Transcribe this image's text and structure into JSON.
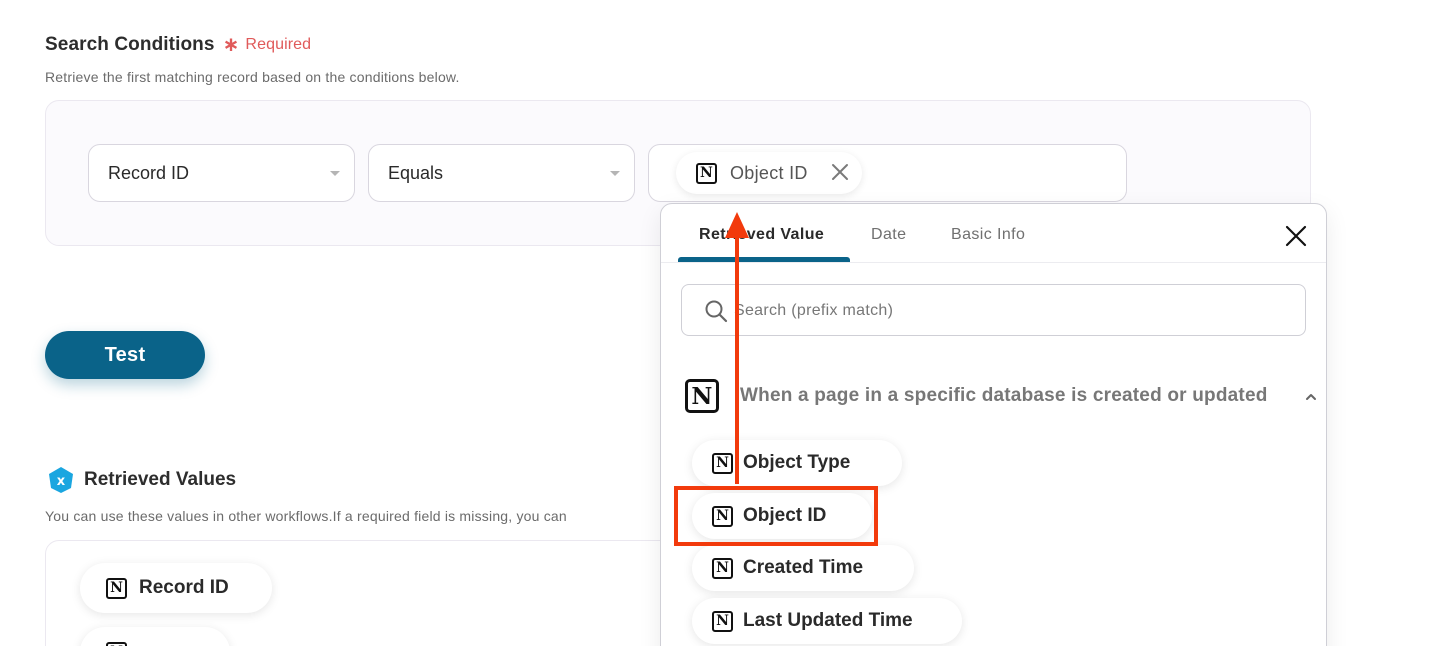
{
  "search_conditions": {
    "title": "Search Conditions",
    "required_star": "∗",
    "required_label": "Required",
    "description": "Retrieve the first matching record based on the conditions below.",
    "field_select": {
      "value": "Record ID"
    },
    "operator_select": {
      "value": "Equals"
    },
    "value_chip": {
      "label": "Object ID",
      "icon": "notion-icon"
    }
  },
  "test_button": {
    "label": "Test"
  },
  "retrieved_values": {
    "title": "Retrieved Values",
    "icon_glyph": "x",
    "description": "You can use these values in other workflows.If a required field is missing, you can",
    "items": [
      {
        "label": "Record ID",
        "icon": "notion-icon"
      }
    ]
  },
  "popup": {
    "tabs": [
      {
        "label": "Retrieved Value",
        "active": true
      },
      {
        "label": "Date",
        "active": false
      },
      {
        "label": "Basic Info",
        "active": false
      }
    ],
    "search_placeholder": "Search (prefix match)",
    "group": {
      "title": "When a page in a specific database is created or updated",
      "expanded": true,
      "items": [
        {
          "label": "Object Type"
        },
        {
          "label": "Object ID",
          "highlighted": true
        },
        {
          "label": "Created Time"
        },
        {
          "label": "Last Updated Time"
        }
      ]
    }
  },
  "colors": {
    "primary": "#0a6389",
    "required": "#e05a5a",
    "annotation": "#f23a0c",
    "badge": "#1aa6e0"
  },
  "notion_glyph": "N"
}
